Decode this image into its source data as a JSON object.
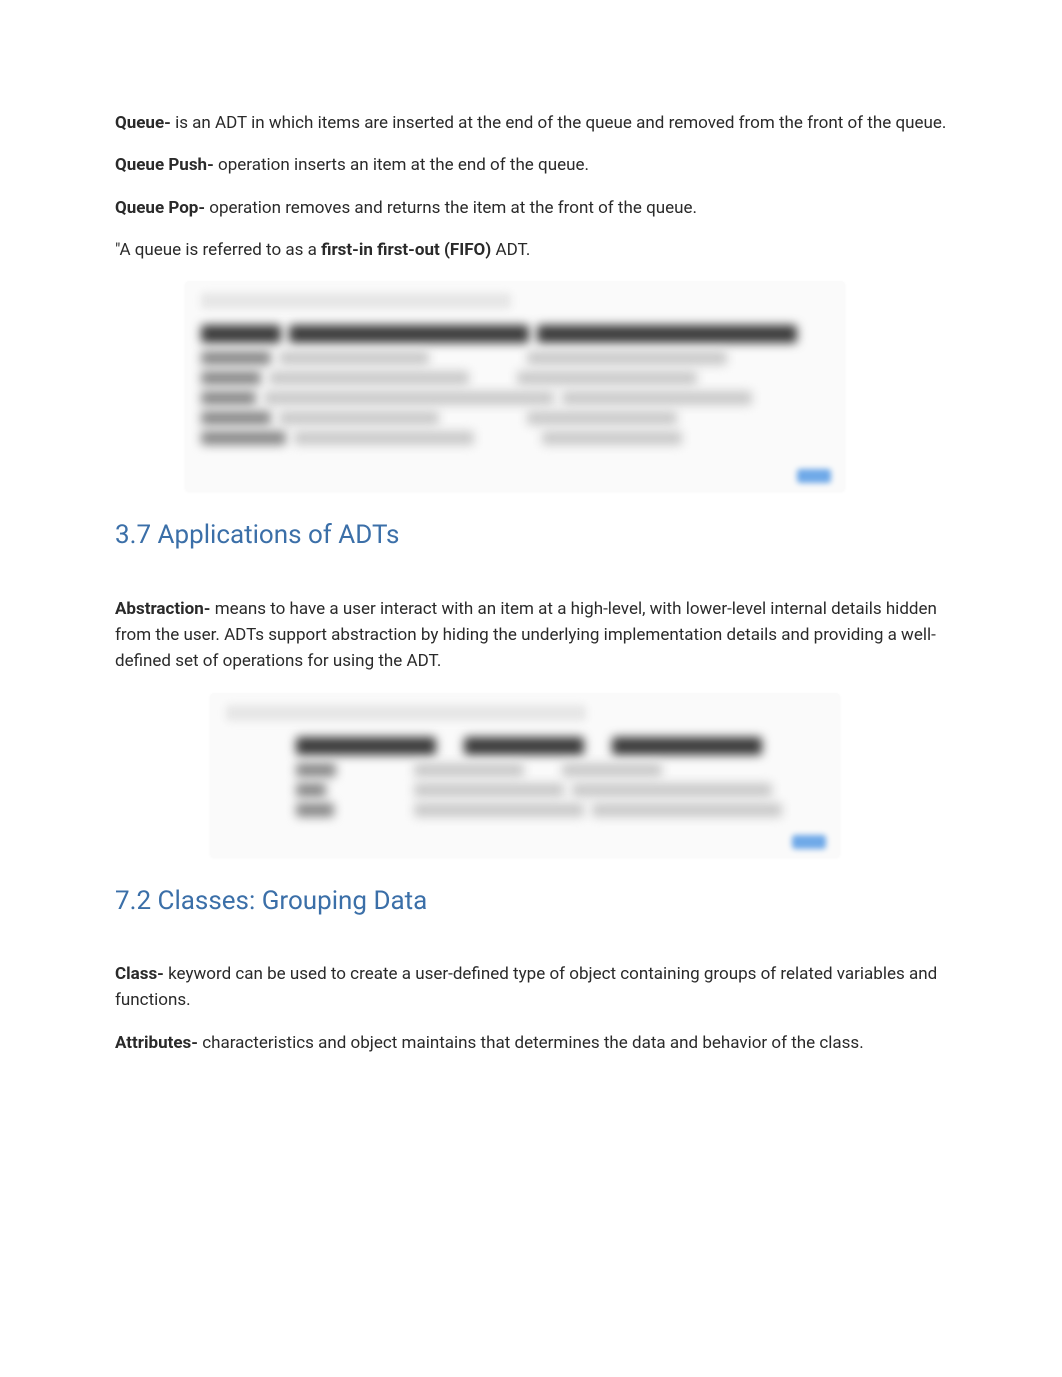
{
  "definitions": {
    "queue": {
      "term": "Queue- ",
      "desc": "is an ADT in which items are inserted at the end of the queue and removed from the front of the queue."
    },
    "queue_push": {
      "term": "Queue Push- ",
      "desc": "operation inserts an item at the end of the queue."
    },
    "queue_pop": {
      "term": "Queue Pop- ",
      "desc": "operation removes and returns the item at the front of the queue."
    },
    "fifo": {
      "prefix": "\"A queue is referred to as a ",
      "bold": "first-in first-out (FIFO) ",
      "suffix": "ADT."
    },
    "abstraction": {
      "term": "Abstraction- ",
      "desc": "means to have a user interact with an item at a high-level, with lower-level internal details hidden from the user. ADTs support abstraction by hiding the underlying implementation details and providing a well-defined set of operations for using the ADT."
    },
    "class": {
      "term": "Class- ",
      "desc": "keyword can be used to create a user-defined type of object containing groups of related variables and functions."
    },
    "attributes": {
      "term": "Attributes- ",
      "desc": "characteristics and object maintains that determines the data and behavior of the class."
    }
  },
  "headings": {
    "applications": "3.7 Applications of ADTs",
    "classes": "7.2 Classes: Grouping Data"
  }
}
